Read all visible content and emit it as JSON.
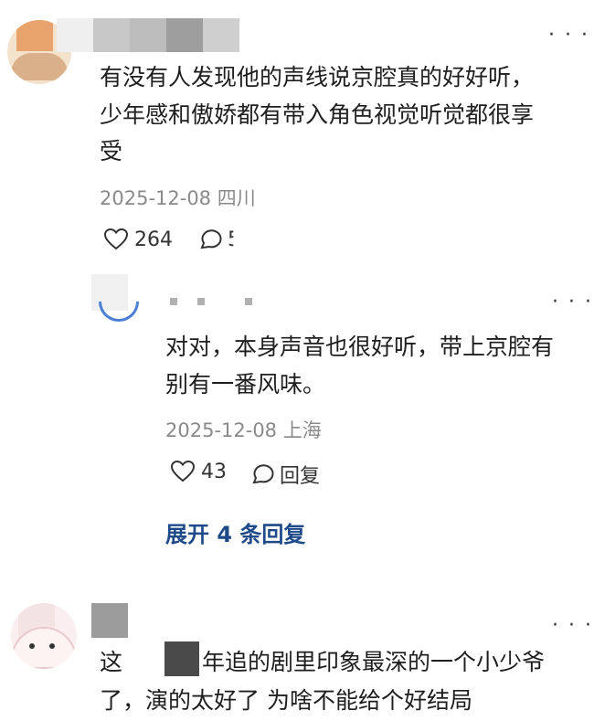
{
  "comments": [
    {
      "text_lines": [
        "有没有人发现他的声线说京腔真的好好听，",
        "少年感和傲娇都有带入角色视觉听觉都很享",
        "受"
      ],
      "date": "2025-12-08",
      "location": "四川",
      "likes": "264",
      "reply_count_partial": "5",
      "more_icon": "ellipsis-icon",
      "reply": {
        "text_lines": [
          "对对，本身声音也很好听，带上京腔有",
          "别有一番风味。"
        ],
        "date": "2025-12-08",
        "location": "上海",
        "likes": "43",
        "reply_label": "回复",
        "more_icon": "ellipsis-icon"
      },
      "expand_label": "展开 4 条回复"
    },
    {
      "text_prefix": "这",
      "text_line1_suffix": "年追的剧里印象最深的一个小少爷",
      "text_line2": "了，演的太好了 为啥不能给个好结局",
      "more_icon": "ellipsis-icon"
    }
  ]
}
